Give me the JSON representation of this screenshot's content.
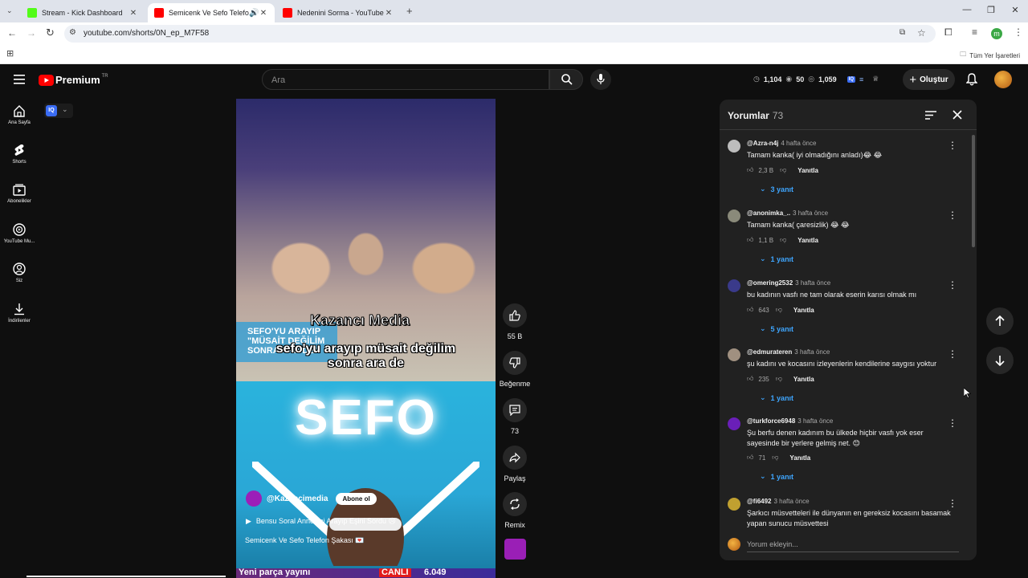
{
  "browser": {
    "tabs": [
      {
        "title": "Stream - Kick Dashboard",
        "favicon_color": "#53fc18"
      },
      {
        "title": "Semicenk Ve Sefo Telefon Şakası",
        "favicon_color": "#ff0000"
      },
      {
        "title": "Nedenini Sorma - YouTube",
        "favicon_color": "#ff0000"
      }
    ],
    "url": "youtube.com/shorts/0N_ep_M7F58",
    "bookmarks_all": "Tüm Yer İşaretleri",
    "profile_letter": "m"
  },
  "header": {
    "logo_text": "Premium",
    "logo_sup": "TR",
    "search_placeholder": "Ara",
    "stat_1": "1,104",
    "stat_2": "50",
    "stat_3": "1,059",
    "create_label": "Oluştur"
  },
  "sidebar": {
    "items": [
      {
        "label": "Ana Sayfa"
      },
      {
        "label": "Shorts"
      },
      {
        "label": "Abonelikler"
      },
      {
        "label": "YouTube Mu..."
      },
      {
        "label": "Siz"
      },
      {
        "label": "İndirilenler"
      }
    ]
  },
  "iq_badge": "IQ",
  "video": {
    "caption_top": "Kazancı Media",
    "caption_line1": "sefo'yu arayıp müsait değilim",
    "caption_line2": "sonra ara de",
    "promo_line1": "SEFO'YU ARAYIP",
    "promo_line2": "\"MÜSAİT DEĞİLİM",
    "promo_line3": "SONRA ARA DE\"",
    "sefo_text": "SEFO",
    "channel_name": "@Kazancimedia",
    "subscribe_label": "Abone ol",
    "linked_video": "Bensu Soral Annesini Arayıp Eşini Sordu 😢",
    "title": "Semicenk Ve Sefo Telefon Şakası 💌",
    "next_strip_1": "Yeni parça yayını",
    "next_strip_2": "CANLI",
    "next_strip_3": "6.049"
  },
  "actions": {
    "like_count": "55 B",
    "dislike_label": "Beğenme",
    "comment_count": "73",
    "share_label": "Paylaş",
    "remix_label": "Remix"
  },
  "comments_panel": {
    "title": "Yorumlar",
    "count": "73",
    "reply_label": "Yanıtla",
    "add_placeholder": "Yorum ekleyin...",
    "items": [
      {
        "author": "@Azra-n4j",
        "time": "4 hafta önce",
        "text": "Tamam kanka( iyi olmadığını anladı)😂 😂",
        "likes": "2,3 B",
        "replies": "3 yanıt",
        "avatar_color": "#bdbdbd"
      },
      {
        "author": "@anonimka_..",
        "time": "3 hafta önce",
        "text": "Tamam kanka( çaresizlik) 😂 😂",
        "likes": "1,1 B",
        "replies": "1 yanıt",
        "avatar_color": "#8a8a7a"
      },
      {
        "author": "@omering2532",
        "time": "3 hafta önce",
        "text": "bu kadının vasfı ne tam olarak eserin karısı olmak mı",
        "likes": "643",
        "replies": "5 yanıt",
        "avatar_color": "#3a3a8a"
      },
      {
        "author": "@edmurateren",
        "time": "3 hafta önce",
        "text": "şu kadını ve kocasını izleyenlerin kendilerine saygısı yoktur",
        "likes": "235",
        "replies": "1 yanıt",
        "avatar_color": "#a09080"
      },
      {
        "author": "@turkforce6948",
        "time": "3 hafta önce",
        "text": "Şu berfu denen kadınım bu ülkede hiçbir vasfı yok eser sayesinde bir yerlere gelmiş net. 😊",
        "likes": "71",
        "replies": "1 yanıt",
        "avatar_color": "#6a1fb8"
      },
      {
        "author": "@fi6492",
        "time": "3 hafta önce",
        "text": "Şarkıcı müsvetteleri ile dünyanın en gereksiz kocasını basamak yapan sunucu müsvettesi",
        "likes": "",
        "replies": "",
        "avatar_color": "#c0a030"
      }
    ]
  }
}
